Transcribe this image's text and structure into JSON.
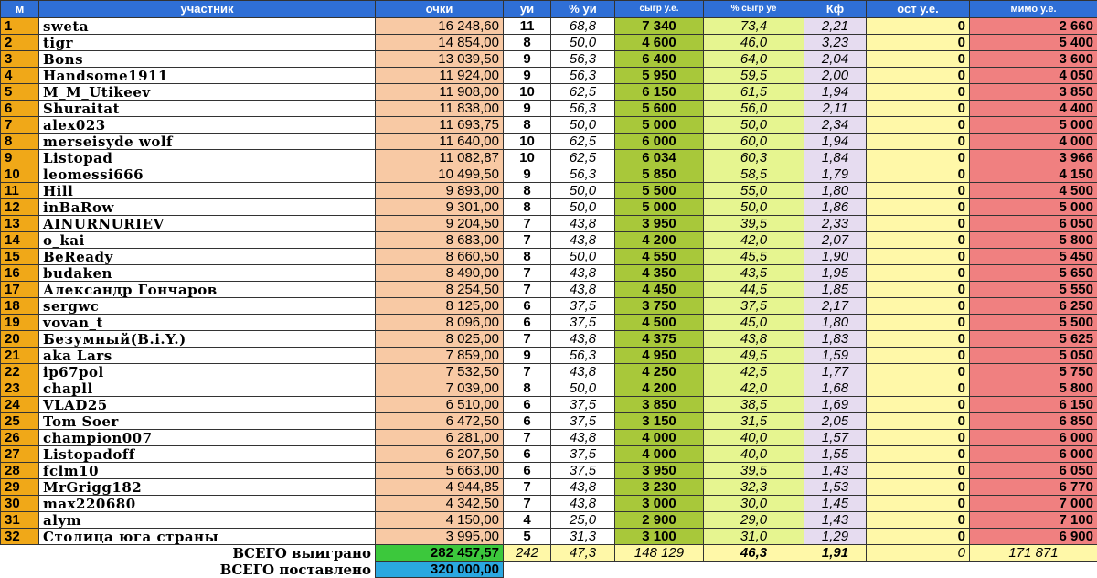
{
  "headers": {
    "rank": "м",
    "name": "участник",
    "points": "очки",
    "ui": "уи",
    "ui_pct": "% уи",
    "won": "сыгр у.е.",
    "won_pct": "% сыгр уе",
    "kf": "Кф",
    "rest": "ост у.е.",
    "miss": "мимо у.е."
  },
  "rows": [
    {
      "rank": "1",
      "name": "sweta",
      "points": "16 248,60",
      "ui": "11",
      "ui_pct": "68,8",
      "won": "7 340",
      "won_pct": "73,4",
      "kf": "2,21",
      "rest": "0",
      "miss": "2 660"
    },
    {
      "rank": "2",
      "name": "tigr",
      "points": "14 854,00",
      "ui": "8",
      "ui_pct": "50,0",
      "won": "4 600",
      "won_pct": "46,0",
      "kf": "3,23",
      "rest": "0",
      "miss": "5 400"
    },
    {
      "rank": "3",
      "name": "Bons",
      "points": "13 039,50",
      "ui": "9",
      "ui_pct": "56,3",
      "won": "6 400",
      "won_pct": "64,0",
      "kf": "2,04",
      "rest": "0",
      "miss": "3 600"
    },
    {
      "rank": "4",
      "name": "Handsome1911",
      "points": "11 924,00",
      "ui": "9",
      "ui_pct": "56,3",
      "won": "5 950",
      "won_pct": "59,5",
      "kf": "2,00",
      "rest": "0",
      "miss": "4 050"
    },
    {
      "rank": "5",
      "name": "M_M_Utikeev",
      "points": "11 908,00",
      "ui": "10",
      "ui_pct": "62,5",
      "won": "6 150",
      "won_pct": "61,5",
      "kf": "1,94",
      "rest": "0",
      "miss": "3 850"
    },
    {
      "rank": "6",
      "name": "Shuraitat",
      "points": "11 838,00",
      "ui": "9",
      "ui_pct": "56,3",
      "won": "5 600",
      "won_pct": "56,0",
      "kf": "2,11",
      "rest": "0",
      "miss": "4 400"
    },
    {
      "rank": "7",
      "name": "alex023",
      "points": "11 693,75",
      "ui": "8",
      "ui_pct": "50,0",
      "won": "5 000",
      "won_pct": "50,0",
      "kf": "2,34",
      "rest": "0",
      "miss": "5 000"
    },
    {
      "rank": "8",
      "name": "merseisyde wolf",
      "points": "11 640,00",
      "ui": "10",
      "ui_pct": "62,5",
      "won": "6 000",
      "won_pct": "60,0",
      "kf": "1,94",
      "rest": "0",
      "miss": "4 000"
    },
    {
      "rank": "9",
      "name": "Listopad",
      "points": "11 082,87",
      "ui": "10",
      "ui_pct": "62,5",
      "won": "6 034",
      "won_pct": "60,3",
      "kf": "1,84",
      "rest": "0",
      "miss": "3 966"
    },
    {
      "rank": "10",
      "name": "leomessi666",
      "points": "10 499,50",
      "ui": "9",
      "ui_pct": "56,3",
      "won": "5 850",
      "won_pct": "58,5",
      "kf": "1,79",
      "rest": "0",
      "miss": "4 150"
    },
    {
      "rank": "11",
      "name": "Hill",
      "points": "9 893,00",
      "ui": "8",
      "ui_pct": "50,0",
      "won": "5 500",
      "won_pct": "55,0",
      "kf": "1,80",
      "rest": "0",
      "miss": "4 500"
    },
    {
      "rank": "12",
      "name": "inBaRow",
      "points": "9 301,00",
      "ui": "8",
      "ui_pct": "50,0",
      "won": "5 000",
      "won_pct": "50,0",
      "kf": "1,86",
      "rest": "0",
      "miss": "5 000"
    },
    {
      "rank": "13",
      "name": "AINURNURIEV",
      "points": "9 204,50",
      "ui": "7",
      "ui_pct": "43,8",
      "won": "3 950",
      "won_pct": "39,5",
      "kf": "2,33",
      "rest": "0",
      "miss": "6 050"
    },
    {
      "rank": "14",
      "name": "o_kai",
      "points": "8 683,00",
      "ui": "7",
      "ui_pct": "43,8",
      "won": "4 200",
      "won_pct": "42,0",
      "kf": "2,07",
      "rest": "0",
      "miss": "5 800"
    },
    {
      "rank": "15",
      "name": "BeReady",
      "points": "8 660,50",
      "ui": "8",
      "ui_pct": "50,0",
      "won": "4 550",
      "won_pct": "45,5",
      "kf": "1,90",
      "rest": "0",
      "miss": "5 450"
    },
    {
      "rank": "16",
      "name": "budaken",
      "points": "8 490,00",
      "ui": "7",
      "ui_pct": "43,8",
      "won": "4 350",
      "won_pct": "43,5",
      "kf": "1,95",
      "rest": "0",
      "miss": "5 650"
    },
    {
      "rank": "17",
      "name": "Александр Гончаров",
      "points": "8 254,50",
      "ui": "7",
      "ui_pct": "43,8",
      "won": "4 450",
      "won_pct": "44,5",
      "kf": "1,85",
      "rest": "0",
      "miss": "5 550"
    },
    {
      "rank": "18",
      "name": "sergwc",
      "points": "8 125,00",
      "ui": "6",
      "ui_pct": "37,5",
      "won": "3 750",
      "won_pct": "37,5",
      "kf": "2,17",
      "rest": "0",
      "miss": "6 250"
    },
    {
      "rank": "19",
      "name": "vovan_t",
      "points": "8 096,00",
      "ui": "6",
      "ui_pct": "37,5",
      "won": "4 500",
      "won_pct": "45,0",
      "kf": "1,80",
      "rest": "0",
      "miss": "5 500"
    },
    {
      "rank": "20",
      "name": "Безумный(B.i.Y.)",
      "points": "8 025,00",
      "ui": "7",
      "ui_pct": "43,8",
      "won": "4 375",
      "won_pct": "43,8",
      "kf": "1,83",
      "rest": "0",
      "miss": "5 625"
    },
    {
      "rank": "21",
      "name": "aka Lars",
      "points": "7 859,00",
      "ui": "9",
      "ui_pct": "56,3",
      "won": "4 950",
      "won_pct": "49,5",
      "kf": "1,59",
      "rest": "0",
      "miss": "5 050"
    },
    {
      "rank": "22",
      "name": "ip67pol",
      "points": "7 532,50",
      "ui": "7",
      "ui_pct": "43,8",
      "won": "4 250",
      "won_pct": "42,5",
      "kf": "1,77",
      "rest": "0",
      "miss": "5 750"
    },
    {
      "rank": "23",
      "name": "chapll",
      "points": "7 039,00",
      "ui": "8",
      "ui_pct": "50,0",
      "won": "4 200",
      "won_pct": "42,0",
      "kf": "1,68",
      "rest": "0",
      "miss": "5 800"
    },
    {
      "rank": "24",
      "name": "VLAD25",
      "points": "6 510,00",
      "ui": "6",
      "ui_pct": "37,5",
      "won": "3 850",
      "won_pct": "38,5",
      "kf": "1,69",
      "rest": "0",
      "miss": "6 150"
    },
    {
      "rank": "25",
      "name": "Tom Soer",
      "points": "6 472,50",
      "ui": "6",
      "ui_pct": "37,5",
      "won": "3 150",
      "won_pct": "31,5",
      "kf": "2,05",
      "rest": "0",
      "miss": "6 850"
    },
    {
      "rank": "26",
      "name": "champion007",
      "points": "6 281,00",
      "ui": "7",
      "ui_pct": "43,8",
      "won": "4 000",
      "won_pct": "40,0",
      "kf": "1,57",
      "rest": "0",
      "miss": "6 000"
    },
    {
      "rank": "27",
      "name": "Listopadoff",
      "points": "6 207,50",
      "ui": "6",
      "ui_pct": "37,5",
      "won": "4 000",
      "won_pct": "40,0",
      "kf": "1,55",
      "rest": "0",
      "miss": "6 000"
    },
    {
      "rank": "28",
      "name": "fclm10",
      "points": "5 663,00",
      "ui": "6",
      "ui_pct": "37,5",
      "won": "3 950",
      "won_pct": "39,5",
      "kf": "1,43",
      "rest": "0",
      "miss": "6 050"
    },
    {
      "rank": "29",
      "name": "MrGrigg182",
      "points": "4 944,85",
      "ui": "7",
      "ui_pct": "43,8",
      "won": "3 230",
      "won_pct": "32,3",
      "kf": "1,53",
      "rest": "0",
      "miss": "6 770"
    },
    {
      "rank": "30",
      "name": "max220680",
      "points": "4 342,50",
      "ui": "7",
      "ui_pct": "43,8",
      "won": "3 000",
      "won_pct": "30,0",
      "kf": "1,45",
      "rest": "0",
      "miss": "7 000"
    },
    {
      "rank": "31",
      "name": "alym",
      "points": "4 150,00",
      "ui": "4",
      "ui_pct": "25,0",
      "won": "2 900",
      "won_pct": "29,0",
      "kf": "1,43",
      "rest": "0",
      "miss": "7 100"
    },
    {
      "rank": "32",
      "name": "Столица юга страны",
      "points": "3 995,00",
      "ui": "5",
      "ui_pct": "31,3",
      "won": "3 100",
      "won_pct": "31,0",
      "kf": "1,29",
      "rest": "0",
      "miss": "6 900"
    }
  ],
  "totals": {
    "won_label": "ВСЕГО выиграно",
    "won_points": "282 457,57",
    "ui": "242",
    "ui_pct": "47,3",
    "won": "148 129",
    "won_pct": "46,3",
    "kf": "1,91",
    "rest": "0",
    "miss": "171 871",
    "bet_label": "ВСЕГО поставлено",
    "bet_points": "320 000,00"
  },
  "colors": {
    "header": "#2f6fd6",
    "rank": "#f0a818",
    "points": "#f8c9a4",
    "won": "#a8c83a",
    "won_pct": "#e6f590",
    "kf": "#e6dcf0",
    "rest": "#fff8a8",
    "miss": "#f08080",
    "total_won": "#3cc83c",
    "total_bet": "#2aa8e0"
  }
}
